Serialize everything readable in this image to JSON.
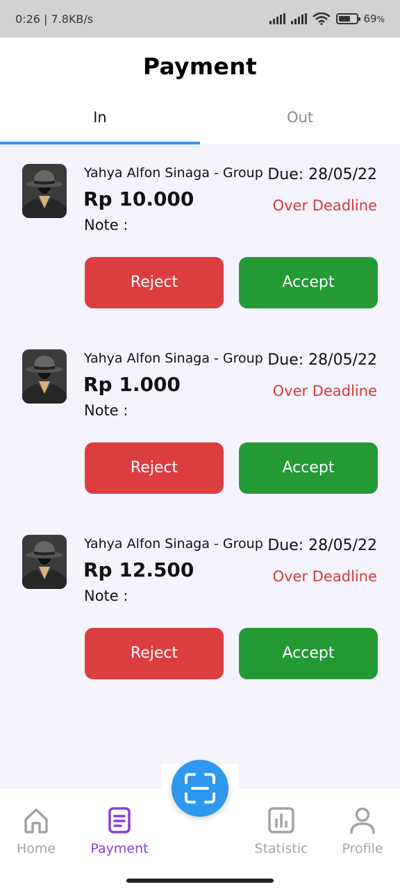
{
  "status_bar": {
    "time_speed": "0:26 | 7.8KB/s",
    "battery_percent": "69",
    "battery_unit": "%"
  },
  "header": {
    "title": "Payment"
  },
  "tabs": [
    {
      "label": "In",
      "active": true
    },
    {
      "label": "Out",
      "active": false
    }
  ],
  "payments": [
    {
      "payer": "Yahya Alfon Sinaga - Group",
      "due": "Due: 28/05/22",
      "amount": "Rp 10.000",
      "status": "Over Deadline",
      "note": "Note :",
      "reject_label": "Reject",
      "accept_label": "Accept"
    },
    {
      "payer": "Yahya Alfon Sinaga - Group",
      "due": "Due: 28/05/22",
      "amount": "Rp 1.000",
      "status": "Over Deadline",
      "note": "Note :",
      "reject_label": "Reject",
      "accept_label": "Accept"
    },
    {
      "payer": "Yahya Alfon Sinaga - Group",
      "due": "Due: 28/05/22",
      "amount": "Rp 12.500",
      "status": "Over Deadline",
      "note": "Note :",
      "reject_label": "Reject",
      "accept_label": "Accept"
    }
  ],
  "bottom_nav": [
    {
      "label": "Home",
      "icon": "home-icon",
      "active": false
    },
    {
      "label": "Payment",
      "icon": "document-icon",
      "active": true
    },
    {
      "label": "Statistic",
      "icon": "bar-chart-icon",
      "active": false
    },
    {
      "label": "Profile",
      "icon": "user-icon",
      "active": false
    }
  ],
  "fab": {
    "icon": "scan-icon"
  },
  "colors": {
    "accent": "#2f97ee",
    "tab_indicator": "#3b8ee0",
    "reject": "#dc3e40",
    "accept": "#249a35",
    "deadline": "#d5393d",
    "nav_active": "#8a3fd0",
    "background": "#f5f4fd"
  }
}
